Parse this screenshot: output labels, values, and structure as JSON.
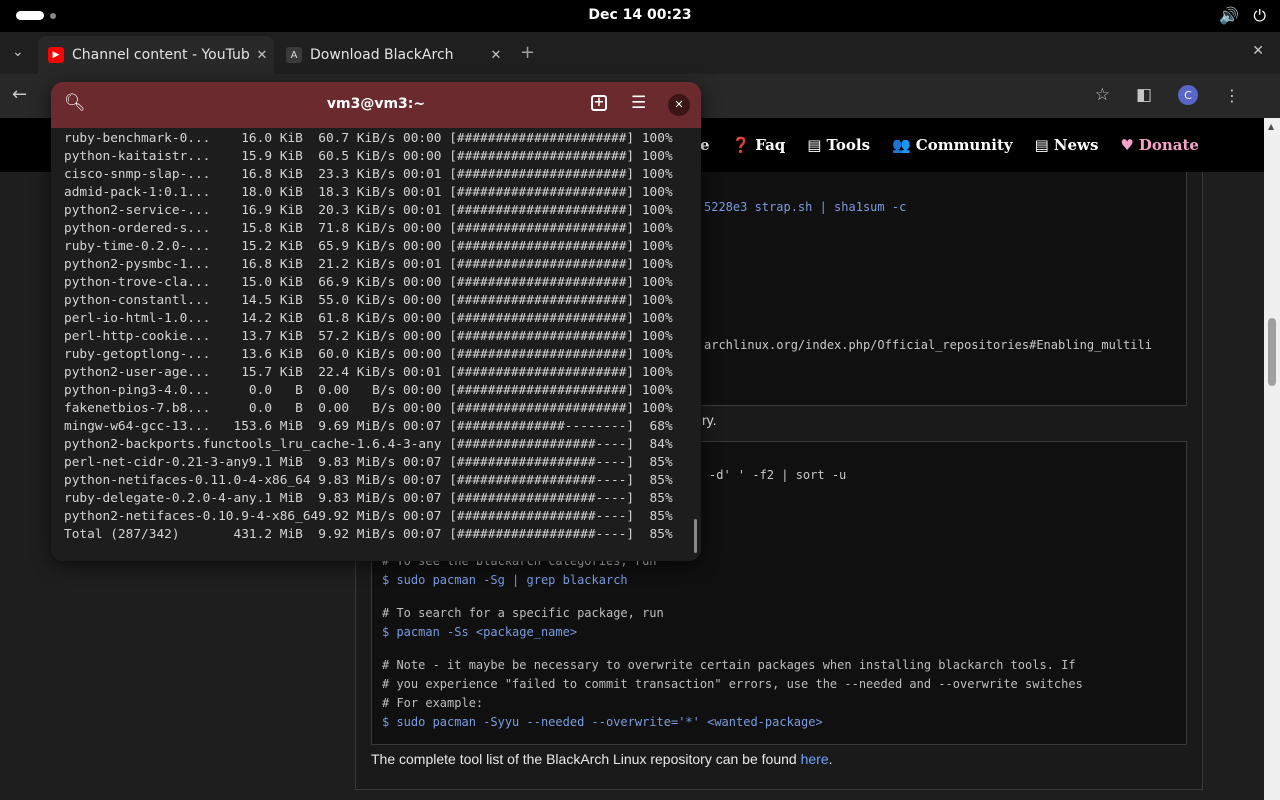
{
  "topbar": {
    "clock": "Dec 14  00:23",
    "icons": [
      "volume-icon",
      "power-icon"
    ]
  },
  "browser": {
    "tabs": [
      {
        "title": "Channel content - YouTube",
        "active": true,
        "icon": "youtube-icon"
      },
      {
        "title": "Download BlackArch",
        "active": false,
        "icon": "blackarch-icon"
      }
    ],
    "new_tab": "+",
    "profile_initial": "C"
  },
  "site": {
    "nav": [
      {
        "icon": "❓",
        "label": "Faq"
      },
      {
        "icon": "▤",
        "label": "Tools"
      },
      {
        "icon": "👥",
        "label": "Community"
      },
      {
        "icon": "▤",
        "label": "News"
      },
      {
        "icon": "♥",
        "label": "Donate"
      }
    ],
    "nav_partial": "e",
    "code1_fragment_1": "5228e3 strap.sh | sha1sum -c",
    "code1_fragment_2": "archlinux.org/index.php/Official_repositories#Enabling_multili",
    "text_fragment_1": "ry.",
    "code2_fragment_1": "-d' ' -f2 | sort -u",
    "code2_lines": [
      {
        "text": "# To see the blackarch categories, run",
        "cls": "gray"
      },
      {
        "text": "$ sudo pacman -Sg | grep blackarch",
        "cls": "blue"
      },
      {
        "text": "",
        "cls": "gray"
      },
      {
        "text": "# To search for a specific package, run",
        "cls": "gray"
      },
      {
        "text": "$ pacman -Ss <package_name>",
        "cls": "blue"
      },
      {
        "text": "",
        "cls": "gray"
      },
      {
        "text": "# Note - it maybe be necessary to overwrite certain packages when installing blackarch tools. If",
        "cls": "gray"
      },
      {
        "text": "# you experience \"failed to commit transaction\" errors, use the --needed and --overwrite switches",
        "cls": "gray"
      },
      {
        "text": "# For example:",
        "cls": "gray"
      },
      {
        "text": "$ sudo pacman -Syyu --needed --overwrite='*' <wanted-package>",
        "cls": "blue"
      }
    ],
    "footer_text": "The complete tool list of the BlackArch Linux repository can be found ",
    "footer_link": "here",
    "footer_end": "."
  },
  "terminal": {
    "title": "vm3@vm3:~",
    "lines": [
      "ruby-benchmark-0...    16.0 KiB  60.7 KiB/s 00:00 [######################] 100%",
      "python-kaitaistr...    15.9 KiB  60.5 KiB/s 00:00 [######################] 100%",
      "cisco-snmp-slap-...    16.8 KiB  23.3 KiB/s 00:01 [######################] 100%",
      "admid-pack-1:0.1...    18.0 KiB  18.3 KiB/s 00:01 [######################] 100%",
      "python2-service-...    16.9 KiB  20.3 KiB/s 00:01 [######################] 100%",
      "python-ordered-s...    15.8 KiB  71.8 KiB/s 00:00 [######################] 100%",
      "ruby-time-0.2.0-...    15.2 KiB  65.9 KiB/s 00:00 [######################] 100%",
      "python2-pysmbc-1...    16.8 KiB  21.2 KiB/s 00:01 [######################] 100%",
      "python-trove-cla...    15.0 KiB  66.9 KiB/s 00:00 [######################] 100%",
      "python-constantl...    14.5 KiB  55.0 KiB/s 00:00 [######################] 100%",
      "perl-io-html-1.0...    14.2 KiB  61.8 KiB/s 00:00 [######################] 100%",
      "perl-http-cookie...    13.7 KiB  57.2 KiB/s 00:00 [######################] 100%",
      "ruby-getoptlong-...    13.6 KiB  60.0 KiB/s 00:00 [######################] 100%",
      "python2-user-age...    15.7 KiB  22.4 KiB/s 00:01 [######################] 100%",
      "python-ping3-4.0...     0.0   B  0.00   B/s 00:00 [######################] 100%",
      "fakenetbios-7.b8...     0.0   B  0.00   B/s 00:00 [######################] 100%",
      "mingw-w64-gcc-13...   153.6 MiB  9.69 MiB/s 00:07 [##############--------]  68%",
      "python2-backports.functools_lru_cache-1.6.4-3-any [##################----]  84%",
      "perl-net-cidr-0.21-3-any9.1 MiB  9.83 MiB/s 00:07 [##################----]  85%",
      "python-netifaces-0.11.0-4-x86_64 9.83 MiB/s 00:07 [##################----]  85%",
      "ruby-delegate-0.2.0-4-any.1 MiB  9.83 MiB/s 00:07 [##################----]  85%",
      "python2-netifaces-0.10.9-4-x86_649.92 MiB/s 00:07 [##################----]  85%",
      "Total (287/342)       431.2 MiB  9.92 MiB/s 00:07 [##################----]  85%"
    ]
  }
}
